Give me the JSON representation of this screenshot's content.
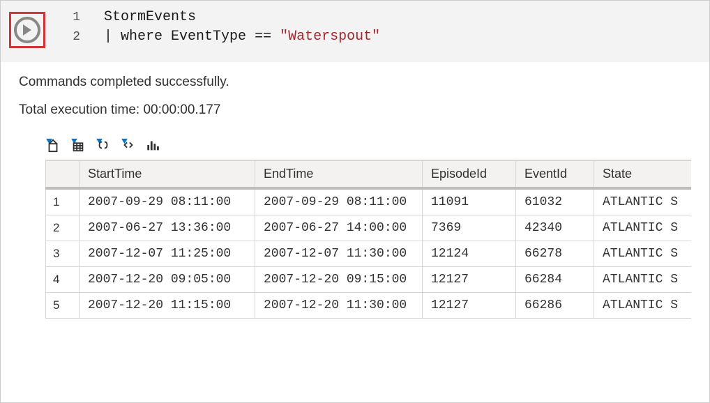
{
  "editor": {
    "lines": [
      {
        "lineno": "1",
        "plain": "StormEvents"
      },
      {
        "lineno": "2",
        "pipe": "| ",
        "keyword": "where ",
        "field": "EventType ",
        "op": "== ",
        "string": "\"Waterspout\""
      }
    ]
  },
  "results": {
    "status": "Commands completed successfully.",
    "exec_time": "Total execution time: 00:00:00.177",
    "columns": [
      "StartTime",
      "EndTime",
      "EpisodeId",
      "EventId",
      "State"
    ],
    "rows": [
      {
        "idx": "1",
        "StartTime": "2007-09-29 08:11:00",
        "EndTime": "2007-09-29 08:11:00",
        "EpisodeId": "11091",
        "EventId": "61032",
        "State": "ATLANTIC S"
      },
      {
        "idx": "2",
        "StartTime": "2007-06-27 13:36:00",
        "EndTime": "2007-06-27 14:00:00",
        "EpisodeId": "7369",
        "EventId": "42340",
        "State": "ATLANTIC S"
      },
      {
        "idx": "3",
        "StartTime": "2007-12-07 11:25:00",
        "EndTime": "2007-12-07 11:30:00",
        "EpisodeId": "12124",
        "EventId": "66278",
        "State": "ATLANTIC S"
      },
      {
        "idx": "4",
        "StartTime": "2007-12-20 09:05:00",
        "EndTime": "2007-12-20 09:15:00",
        "EpisodeId": "12127",
        "EventId": "66284",
        "State": "ATLANTIC S"
      },
      {
        "idx": "5",
        "StartTime": "2007-12-20 11:15:00",
        "EndTime": "2007-12-20 11:30:00",
        "EpisodeId": "12127",
        "EventId": "66286",
        "State": "ATLANTIC S"
      }
    ]
  },
  "toolbar": {
    "icons": [
      {
        "name": "export-csv-icon"
      },
      {
        "name": "export-xlsx-icon"
      },
      {
        "name": "expand-json-icon"
      },
      {
        "name": "expand-code-icon"
      },
      {
        "name": "chart-icon"
      }
    ]
  }
}
